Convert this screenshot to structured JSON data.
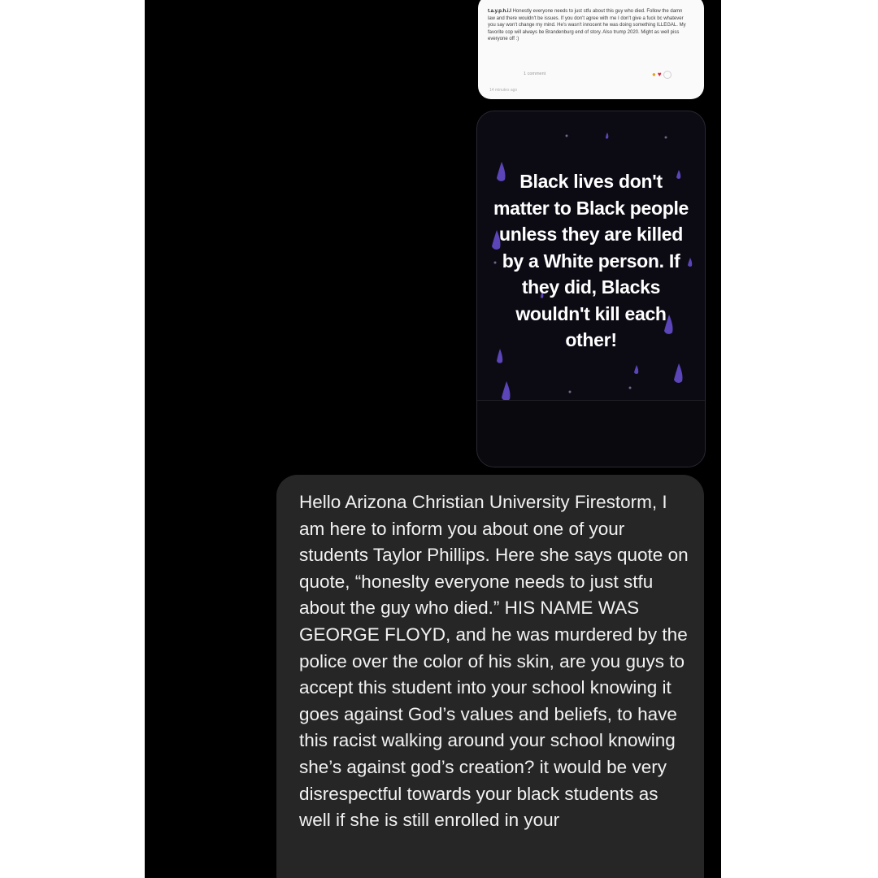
{
  "comment_screenshot": {
    "username": "t.a.y.p.h.i.l",
    "text": "Honestly everyone needs to just stfu about this guy who died. Follow the damn law and there wouldn't be issues. If you don't agree with me I don't give a fuck bc whatever you say won't change my mind. He's wasn't innocent he was doing something ILLEGAL. My favorite cop will always be Brandenburg end of story. Also trump 2020. Might as well piss everyone off :)",
    "comment_count": "1 comment",
    "time": "14 minutes ago",
    "reactions": [
      "laugh-react-icon",
      "heart-react-icon",
      "add-react-icon"
    ],
    "colors": {
      "background": "#fafafa",
      "laugh": "#e0a321",
      "heart": "#d6233a"
    }
  },
  "story": {
    "text": "Black lives don't matter to Black people unless they are killed by a White person. If they did, Blacks wouldn't kill each other!",
    "colors": {
      "background": "#0c0b14",
      "drops": "#5b45b8",
      "text": "#ffffff"
    }
  },
  "message": {
    "text": "Hello Arizona Christian University Firestorm, I am here to inform you about one of your students Taylor Phillips. Here she says quote on quote, “honeslty everyone needs to just stfu about the guy who died.” HIS NAME WAS GEORGE FLOYD, and he was murdered by the police over the color of his skin, are you guys to accept this student into your school knowing it goes against God’s values and beliefs, to have this racist walking around your school knowing she’s against god’s creation? it would be very disrespectful towards your black students as well if she is still enrolled in your",
    "colors": {
      "bubble": "#262626",
      "text": "#f2f2f2"
    }
  },
  "theme": {
    "page": "#ffffff",
    "chat_background": "#000000"
  }
}
